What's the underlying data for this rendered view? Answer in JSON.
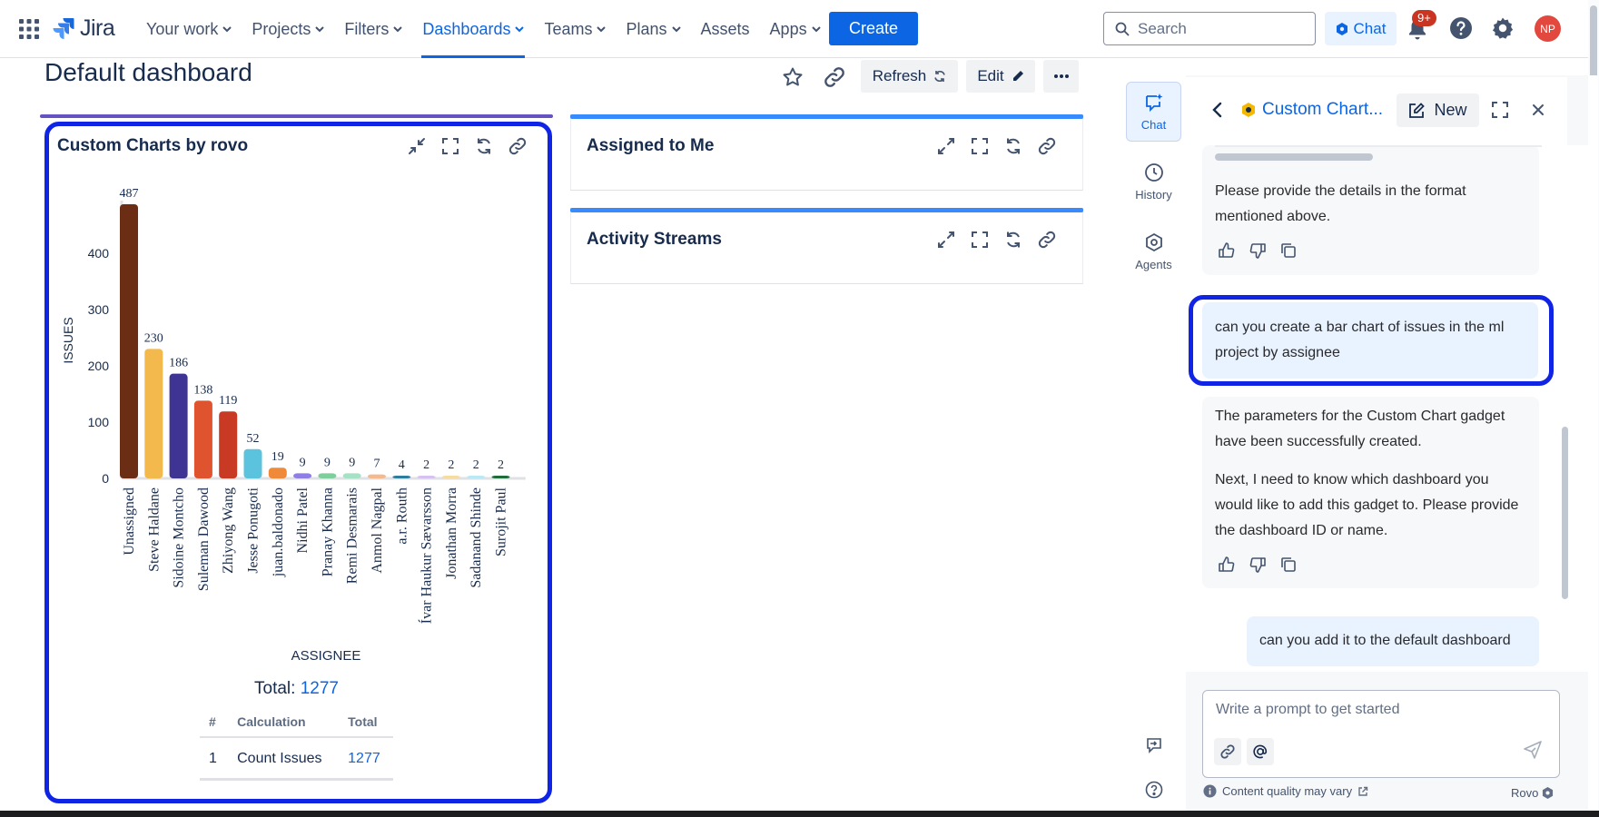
{
  "nav": {
    "logo": "Jira",
    "items": [
      {
        "label": "Your work",
        "dropdown": true
      },
      {
        "label": "Projects",
        "dropdown": true
      },
      {
        "label": "Filters",
        "dropdown": true
      },
      {
        "label": "Dashboards",
        "dropdown": true,
        "active": true
      },
      {
        "label": "Teams",
        "dropdown": true
      },
      {
        "label": "Plans",
        "dropdown": true
      },
      {
        "label": "Assets",
        "dropdown": false
      },
      {
        "label": "Apps",
        "dropdown": true
      }
    ],
    "create": "Create",
    "search_placeholder": "Search",
    "chat": "Chat",
    "notif_badge": "9+",
    "avatar": "NP"
  },
  "page": {
    "title": "Default dashboard",
    "refresh": "Refresh",
    "edit": "Edit"
  },
  "gadgets": {
    "custom": {
      "title": "Custom Charts by rovo",
      "total_label": "Total:",
      "total_value": "1277",
      "table": {
        "headers": [
          "#",
          "Calculation",
          "Total"
        ],
        "rows": [
          [
            "1",
            "Count Issues",
            "1277"
          ]
        ]
      }
    },
    "assigned": {
      "title": "Assigned to Me"
    },
    "activity": {
      "title": "Activity Streams"
    }
  },
  "chart_data": {
    "type": "bar",
    "xlabel": "ASSIGNEE",
    "ylabel": "ISSUES",
    "ylim": [
      0,
      487
    ],
    "yticks": [
      0,
      100,
      200,
      300,
      400
    ],
    "grid": false,
    "categories": [
      "Unassigned",
      "Steve Haldane",
      "Sidoine Montcho",
      "Suleman Dawood",
      "Zhiyong Wang",
      "Jesse Ponugoti",
      "juan.baldonado",
      "Nidhi Patel",
      "Pranay Khanna",
      "Remi Desmarais",
      "Anmol Nagpal",
      "a.r. Routh",
      "Ívar Haukur Sævarsson",
      "Jonathan Morra",
      "Sadanand Shinde",
      "Surojit Paul"
    ],
    "values": [
      487,
      230,
      186,
      138,
      119,
      52,
      19,
      9,
      9,
      9,
      7,
      4,
      2,
      2,
      2,
      2
    ],
    "colors": [
      "#6b2e15",
      "#f3b94c",
      "#3f3393",
      "#e0532f",
      "#c83a23",
      "#5bc3dd",
      "#f08a3b",
      "#8f7ee6",
      "#7fcf9c",
      "#a5e1c4",
      "#f6b88d",
      "#2e7c9e",
      "#d7c1f0",
      "#f7dca1",
      "#b8e9f4",
      "#1f6b3a"
    ]
  },
  "rovo": {
    "rail": {
      "chat": "Chat",
      "history": "History",
      "agents": "Agents"
    },
    "header_title": "Custom Chart...",
    "new": "New",
    "messages": {
      "bot1": "Please provide the details in the format mentioned above.",
      "user1": "can you create a bar chart of issues in the ml project by assignee",
      "bot2a": "The parameters for the Custom Chart gadget have been successfully created.",
      "bot2b": "Next, I need to know which dashboard you would like to add this gadget to. Please provide the dashboard ID or name.",
      "user2": "can you add it to the default dashboard"
    },
    "prompt_placeholder": "Write a prompt to get started",
    "footnote": "Content quality may vary",
    "brand": "Rovo"
  }
}
